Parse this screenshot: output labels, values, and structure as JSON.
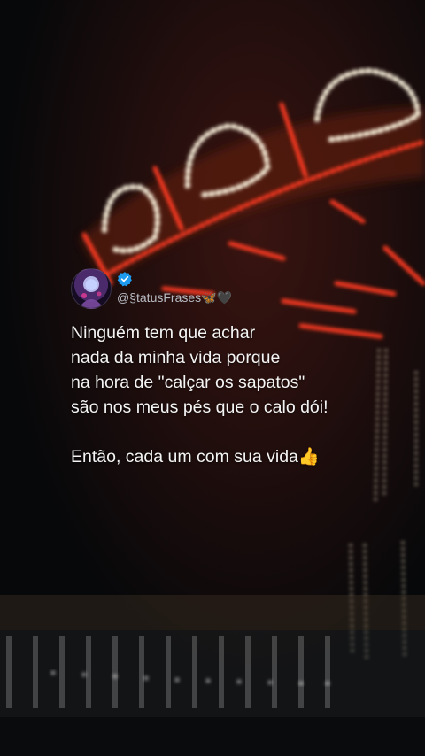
{
  "post": {
    "handle": "@§tatusFrases🦋🖤",
    "text": "Ninguém tem que achar\nnada da minha vida porque\nna hora de \"calçar os sapatos\"\nsão nos meus pés que o calo dói!\n\nEntão, cada um com sua vida👍",
    "avatar_icon": "avatar-icon",
    "verified_icon": "verified-badge-icon"
  },
  "colors": {
    "accent_verified": "#1d9bf0",
    "text": "#f4f4f4",
    "handle": "#b9bcc4",
    "lights": "#ff4a2c"
  }
}
